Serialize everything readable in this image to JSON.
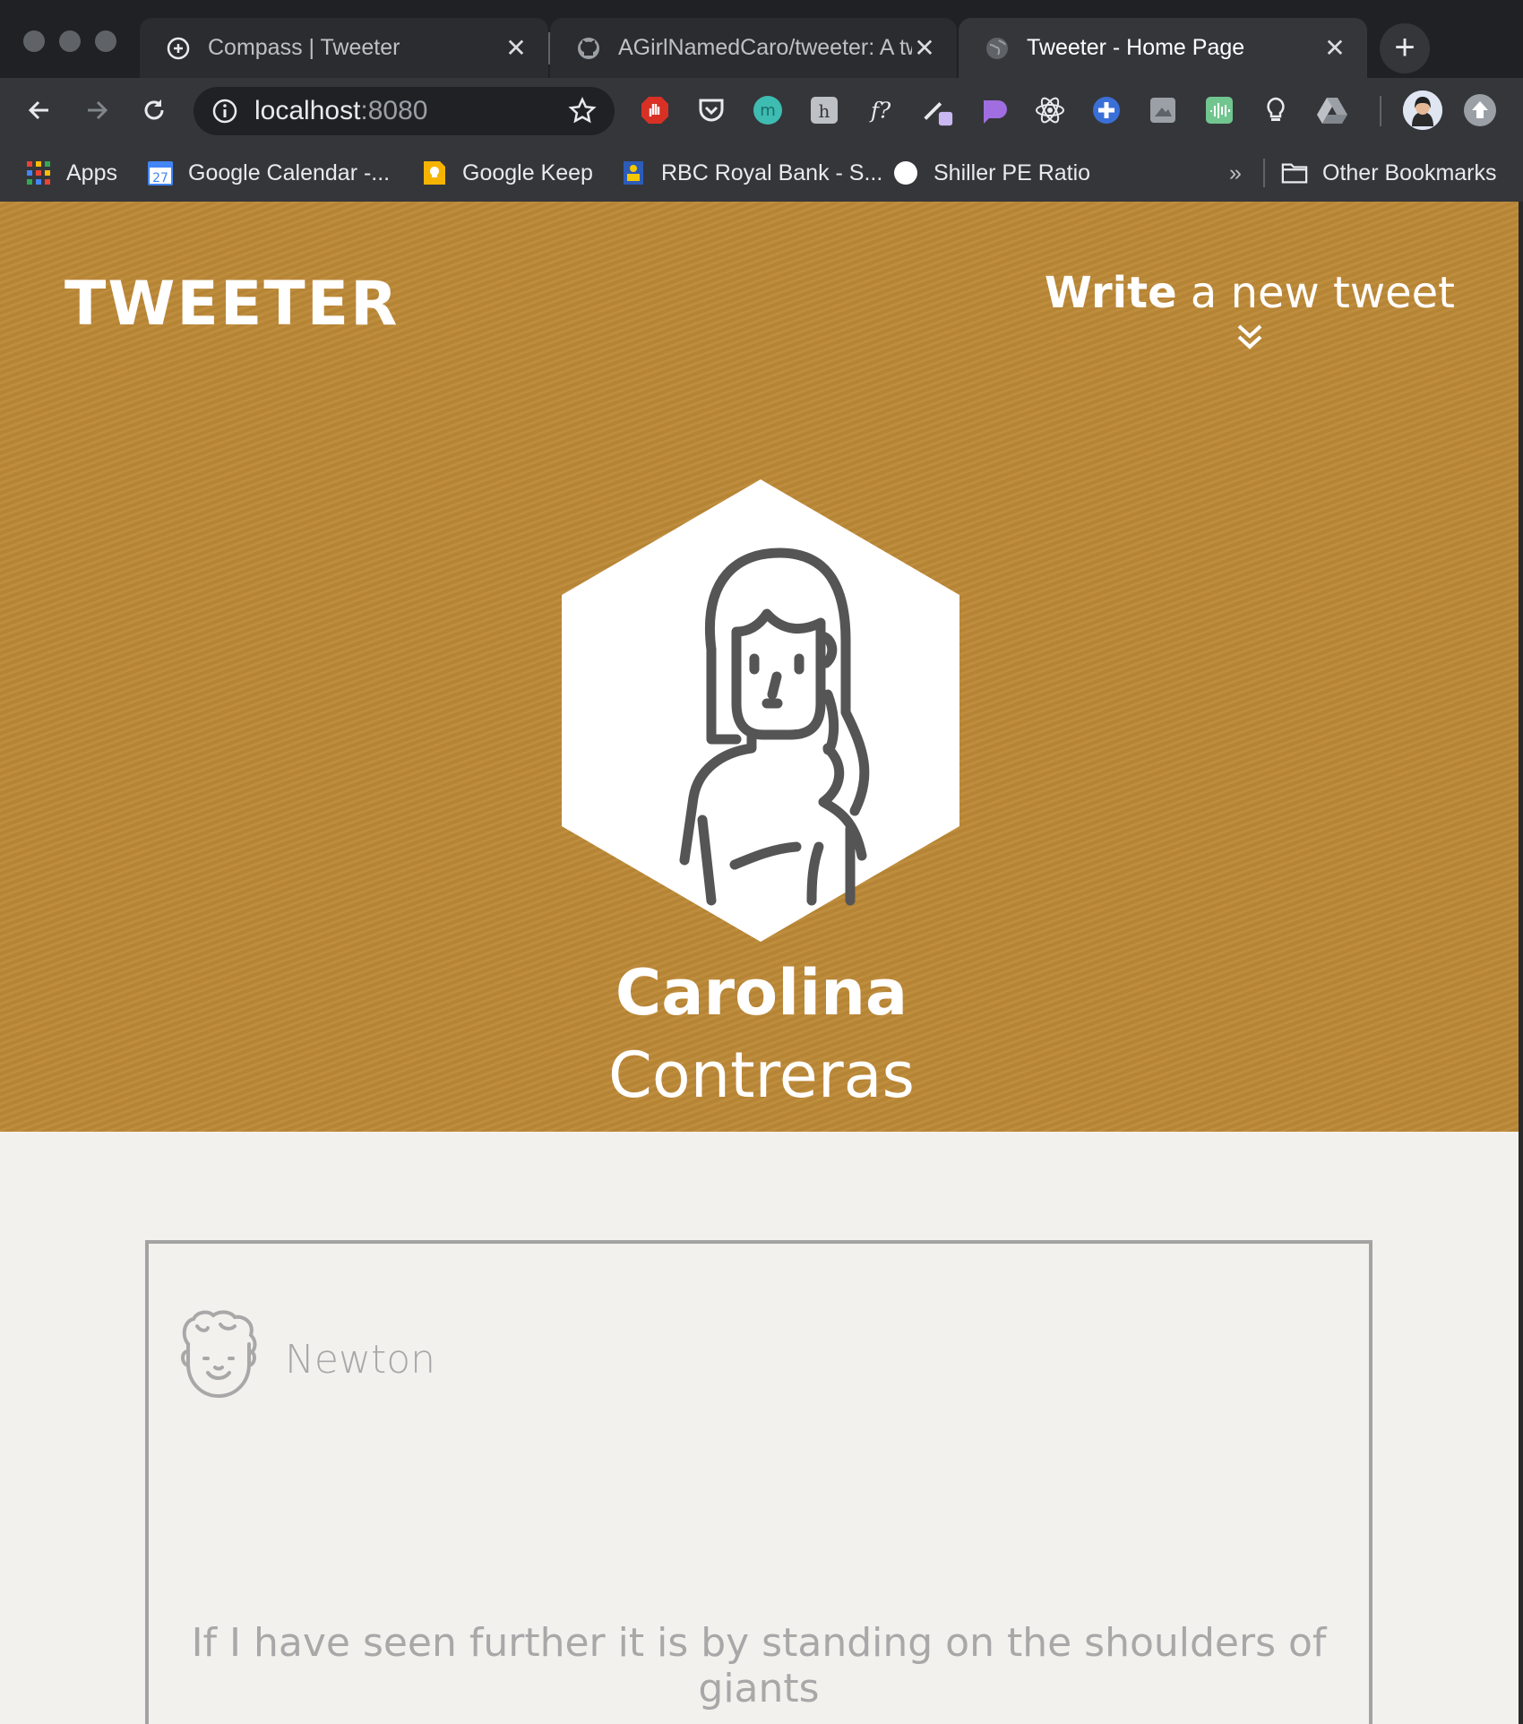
{
  "browser": {
    "tabs": [
      {
        "label": "Compass | Tweeter",
        "icon": "compass-icon",
        "active": false
      },
      {
        "label": "AGirlNamedCaro/tweeter: A tw",
        "icon": "github-icon",
        "active": false
      },
      {
        "label": "Tweeter - Home Page",
        "icon": "globe-icon",
        "active": true
      }
    ],
    "new_tab_label": "+",
    "close_glyph": "✕",
    "url_host": "localhost",
    "url_port": ":8080",
    "bookmarks": [
      {
        "label": "Apps",
        "icon": "apps-grid-icon"
      },
      {
        "label": "Google Calendar -...",
        "icon": "calendar-icon",
        "badge": "27"
      },
      {
        "label": "Google Keep",
        "icon": "keep-icon"
      },
      {
        "label": "RBC Royal Bank - S...",
        "icon": "rbc-icon"
      },
      {
        "label": "Shiller PE Ratio",
        "icon": "circle-icon"
      }
    ],
    "bookmarks_overflow": "»",
    "other_bookmarks": "Other Bookmarks",
    "extensions": [
      "adblock-icon",
      "pocket-icon",
      "mercury-icon",
      "hypothesis-icon",
      "formula-icon",
      "color-picker-icon",
      "popclip-icon",
      "react-devtools-icon",
      "plus-icon",
      "screenshot-icon",
      "audio-icon",
      "keep-bulb-icon",
      "drive-icon"
    ]
  },
  "page": {
    "logo": "TWEETER",
    "compose_bold": "Write",
    "compose_rest": " a new tweet",
    "profile": {
      "first_name": "Carolina",
      "last_name": "Contreras"
    },
    "tweet": {
      "author": "Newton",
      "text": "If I have seen further it is by standing on the shoulders of giants"
    },
    "colors": {
      "hero": "#bd8937",
      "page_bg": "#f3f1ee",
      "tweet_text": "#a8a8a8"
    }
  }
}
